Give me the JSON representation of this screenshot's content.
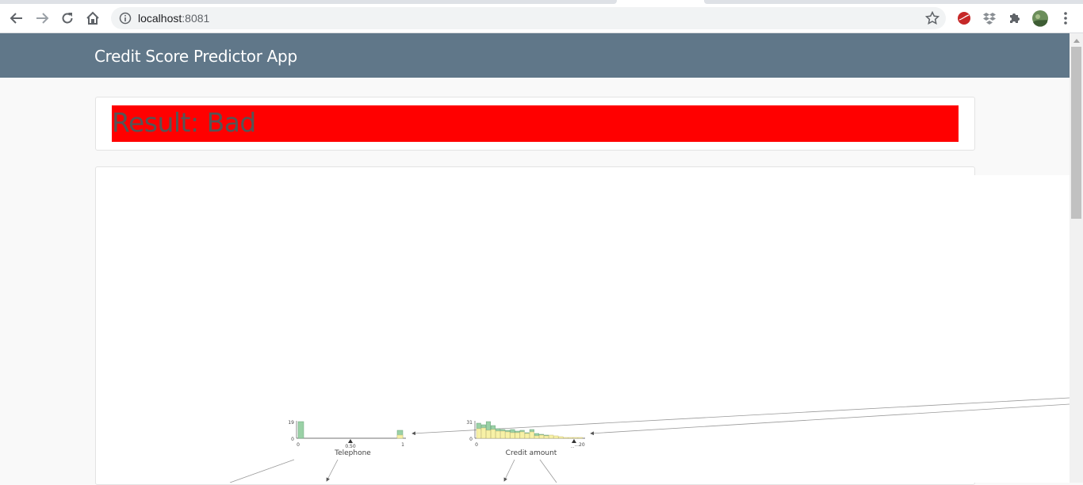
{
  "browser": {
    "url_host": "localhost",
    "url_port": ":8081",
    "icons": {
      "back": "back-arrow-icon",
      "forward": "forward-arrow-icon",
      "reload": "reload-icon",
      "home": "home-icon",
      "info": "info-icon",
      "star": "bookmark-star-icon",
      "ext1": "red-ball-extension-icon",
      "ext2": "dropbox-extension-icon",
      "ext3": "extensions-puzzle-icon",
      "profile": "profile-avatar-icon",
      "menu": "kebab-menu-icon"
    }
  },
  "app": {
    "title": "Credit Score Predictor App",
    "header_color": "#607789",
    "result": {
      "text": "Result: Bad",
      "color": "#ff0000"
    }
  },
  "visualization": {
    "nodes": [
      {
        "feature": "Telephone",
        "count_max": "19",
        "count_min": "0",
        "x_min": "0",
        "x_max": "1",
        "split_value": "0.50",
        "bin_count": 2
      },
      {
        "feature": "Credit amount",
        "count_max": "31",
        "count_min": "0",
        "x_min": "0",
        "x_max": "...20",
        "split_value": "...",
        "bin_count": 22
      }
    ]
  }
}
